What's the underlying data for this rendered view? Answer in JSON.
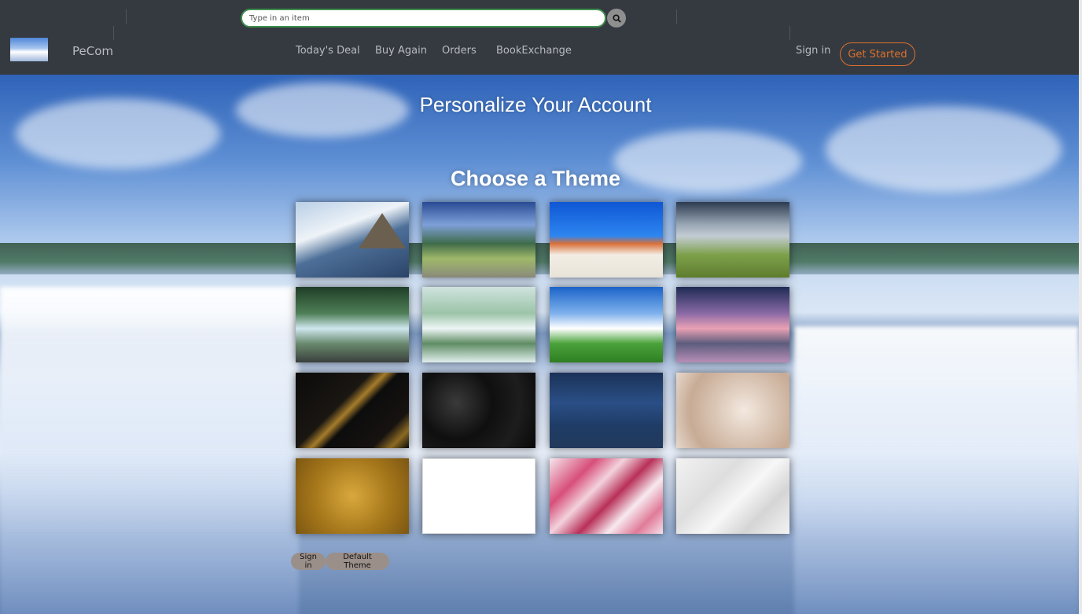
{
  "header": {
    "brand": "PeCom",
    "search_placeholder": "Type in an item",
    "nav": [
      "Today's Deal",
      "Buy Again",
      "Orders",
      "BookExchange"
    ],
    "sign_in": "Sign in",
    "get_started": "Get Started",
    "accent_color": "#e0702c"
  },
  "main": {
    "title": "Personalize Your Account",
    "subtitle": "Choose a Theme",
    "themes": [
      {
        "name": "waterfall-mountain"
      },
      {
        "name": "mountain-lake"
      },
      {
        "name": "desert-tree"
      },
      {
        "name": "cloudy-field"
      },
      {
        "name": "forest-waterfall"
      },
      {
        "name": "tiered-waterfalls"
      },
      {
        "name": "green-meadow-sky"
      },
      {
        "name": "volcano-dusk"
      },
      {
        "name": "black-gold-marble"
      },
      {
        "name": "black-marble"
      },
      {
        "name": "blue-satellite"
      },
      {
        "name": "beige-onyx"
      },
      {
        "name": "gold-floral"
      },
      {
        "name": "white"
      },
      {
        "name": "pink-marble"
      },
      {
        "name": "white-marble"
      }
    ]
  },
  "footer_buttons": {
    "sign_in": "Sign in",
    "default_theme": "Default Theme"
  }
}
